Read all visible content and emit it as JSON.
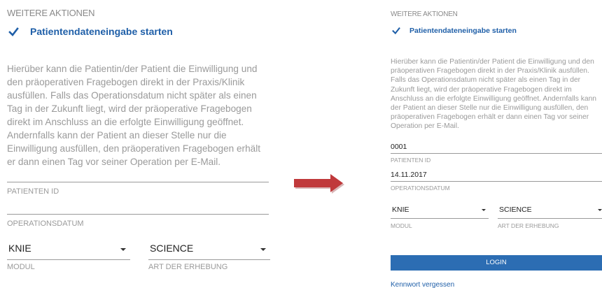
{
  "colors": {
    "accent": "#1f5fa8",
    "checkbox": "#1f5fa8",
    "login_button": "#2c6db3",
    "arrow": "#c0393b",
    "muted_text": "#9a9a9a"
  },
  "before": {
    "section_title": "WEITERE AKTIONEN",
    "checkbox": {
      "label": "Patientendateneingabe starten",
      "checked": true,
      "icon": "checkmark-icon"
    },
    "description": "Hierüber kann die Patientin/der Patient die Einwilligung und den präoperativen Fragebogen direkt in der Praxis/Klinik ausfüllen. Falls das Operationsdatum nicht später als einen Tag in der Zukunft liegt, wird der präoperative Fragebogen direkt im Anschluss an die erfolgte Einwilligung geöffnet. Andernfalls kann der Patient an dieser Stelle nur die Einwilligung ausfüllen, den präoperativen Fragebogen erhält er dann einen Tag vor seiner Operation per E-Mail.",
    "patient_id": {
      "label": "PATIENTEN ID",
      "value": ""
    },
    "operation_date": {
      "label": "OPERATIONSDATUM",
      "value": ""
    },
    "modul": {
      "label": "MODUL",
      "value": "KNIE",
      "icon": "caret-down-icon"
    },
    "art": {
      "label": "ART DER ERHEBUNG",
      "value": "SCIENCE",
      "icon": "caret-down-icon"
    }
  },
  "arrow": {
    "icon": "arrow-right-icon"
  },
  "after": {
    "section_title": "WEITERE AKTIONEN",
    "checkbox": {
      "label": "Patientendateneingabe starten",
      "checked": true,
      "icon": "checkmark-icon"
    },
    "description": "Hierüber kann die Patientin/der Patient die Einwilligung und den präoperativen Fragebogen direkt in der Praxis/Klinik ausfüllen. Falls das Operationsdatum nicht später als einen Tag in der Zukunft liegt, wird der präoperative Fragebogen direkt im Anschluss an die erfolgte Einwilligung geöffnet. Andernfalls kann der Patient an dieser Stelle nur die Einwilligung ausfüllen, den präoperativen Fragebogen erhält er dann einen Tag vor seiner Operation per E-Mail.",
    "patient_id": {
      "label": "PATIENTEN ID",
      "value": "0001"
    },
    "operation_date": {
      "label": "OPERATIONSDATUM",
      "value": "14.11.2017"
    },
    "modul": {
      "label": "MODUL",
      "value": "KNIE",
      "icon": "caret-down-icon"
    },
    "art": {
      "label": "ART DER ERHEBUNG",
      "value": "SCIENCE",
      "icon": "caret-down-icon"
    },
    "login_label": "LOGIN",
    "forgot_password": "Kennwort vergessen"
  }
}
